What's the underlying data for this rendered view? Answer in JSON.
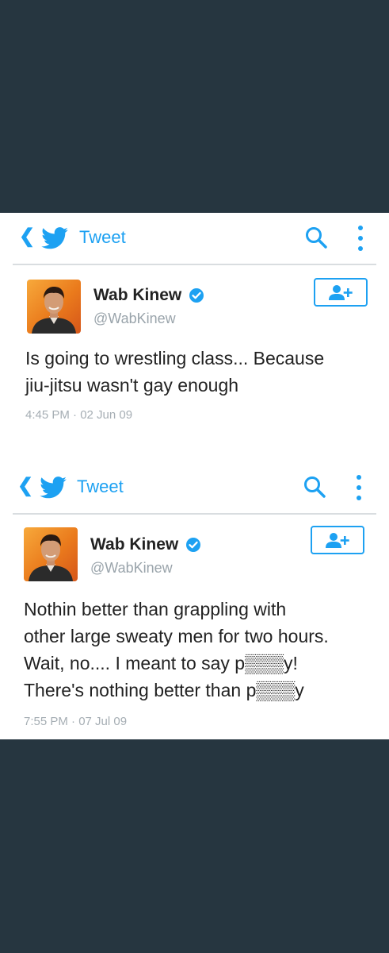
{
  "colors": {
    "accent": "#1da1f2",
    "background": "#263640",
    "panel": "#ffffff"
  },
  "tweets": [
    {
      "header": {
        "back_icon": "chevron-left-icon",
        "title": "Tweet"
      },
      "author": {
        "name": "Wab Kinew",
        "handle": "@WabKinew",
        "verified": true
      },
      "text_lines": [
        "Is going to wrestling class... Because",
        "jiu-jitsu wasn't gay enough"
      ],
      "timestamp": "4:45 PM · 02 Jun 09"
    },
    {
      "header": {
        "back_icon": "chevron-left-icon",
        "title": "Tweet"
      },
      "author": {
        "name": "Wab Kinew",
        "handle": "@WabKinew",
        "verified": true
      },
      "text_lines": [
        "Nothin better than grappling with",
        "other large sweaty men for two hours.",
        "Wait, no.... I meant to say p▒▒▒y!",
        "There's nothing better than p▒▒▒y"
      ],
      "timestamp": "7:55 PM · 07 Jul 09"
    }
  ]
}
